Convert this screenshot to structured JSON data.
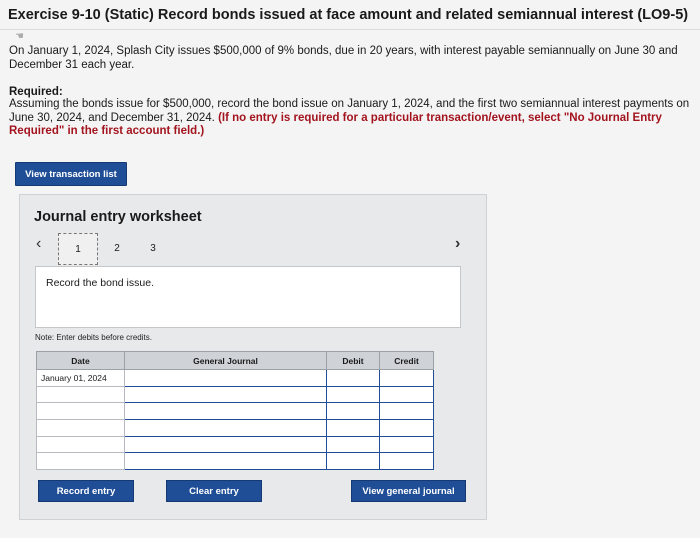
{
  "header": {
    "title": "Exercise 9-10 (Static) Record bonds issued at face amount and related semiannual interest (LO9-5)"
  },
  "intro": {
    "text": "On January 1, 2024, Splash City issues $500,000 of 9% bonds, due in 20 years, with interest payable semiannually on June 30 and December 31 each year."
  },
  "required": {
    "heading": "Required:",
    "body": "Assuming the bonds issue for $500,000, record the bond issue on January 1, 2024, and the first two semiannual interest payments on June 30, 2024, and December 31, 2024.",
    "red_note": "(If no entry is required for a particular transaction/event, select \"No Journal Entry Required\" in the first account field.)"
  },
  "buttons": {
    "view_transaction_list": "View transaction list",
    "record_entry": "Record entry",
    "clear_entry": "Clear entry",
    "view_general_journal": "View general journal"
  },
  "worksheet": {
    "title": "Journal entry worksheet",
    "tabs": [
      "1",
      "2",
      "3"
    ],
    "active_tab": "1",
    "instruction": "Record the bond issue.",
    "note": "Note: Enter debits before credits."
  },
  "journal": {
    "headers": [
      "Date",
      "General Journal",
      "Debit",
      "Credit"
    ],
    "rows": [
      [
        "January 01, 2024",
        "",
        "",
        ""
      ],
      [
        "",
        "",
        "",
        ""
      ],
      [
        "",
        "",
        "",
        ""
      ],
      [
        "",
        "",
        "",
        ""
      ],
      [
        "",
        "",
        "",
        ""
      ],
      [
        "",
        "",
        "",
        ""
      ]
    ]
  },
  "colors": {
    "button_blue": "#1f4e97",
    "red_note": "#a3141f"
  },
  "icons": {
    "prev": "chevron-left-icon",
    "next": "chevron-right-icon"
  }
}
